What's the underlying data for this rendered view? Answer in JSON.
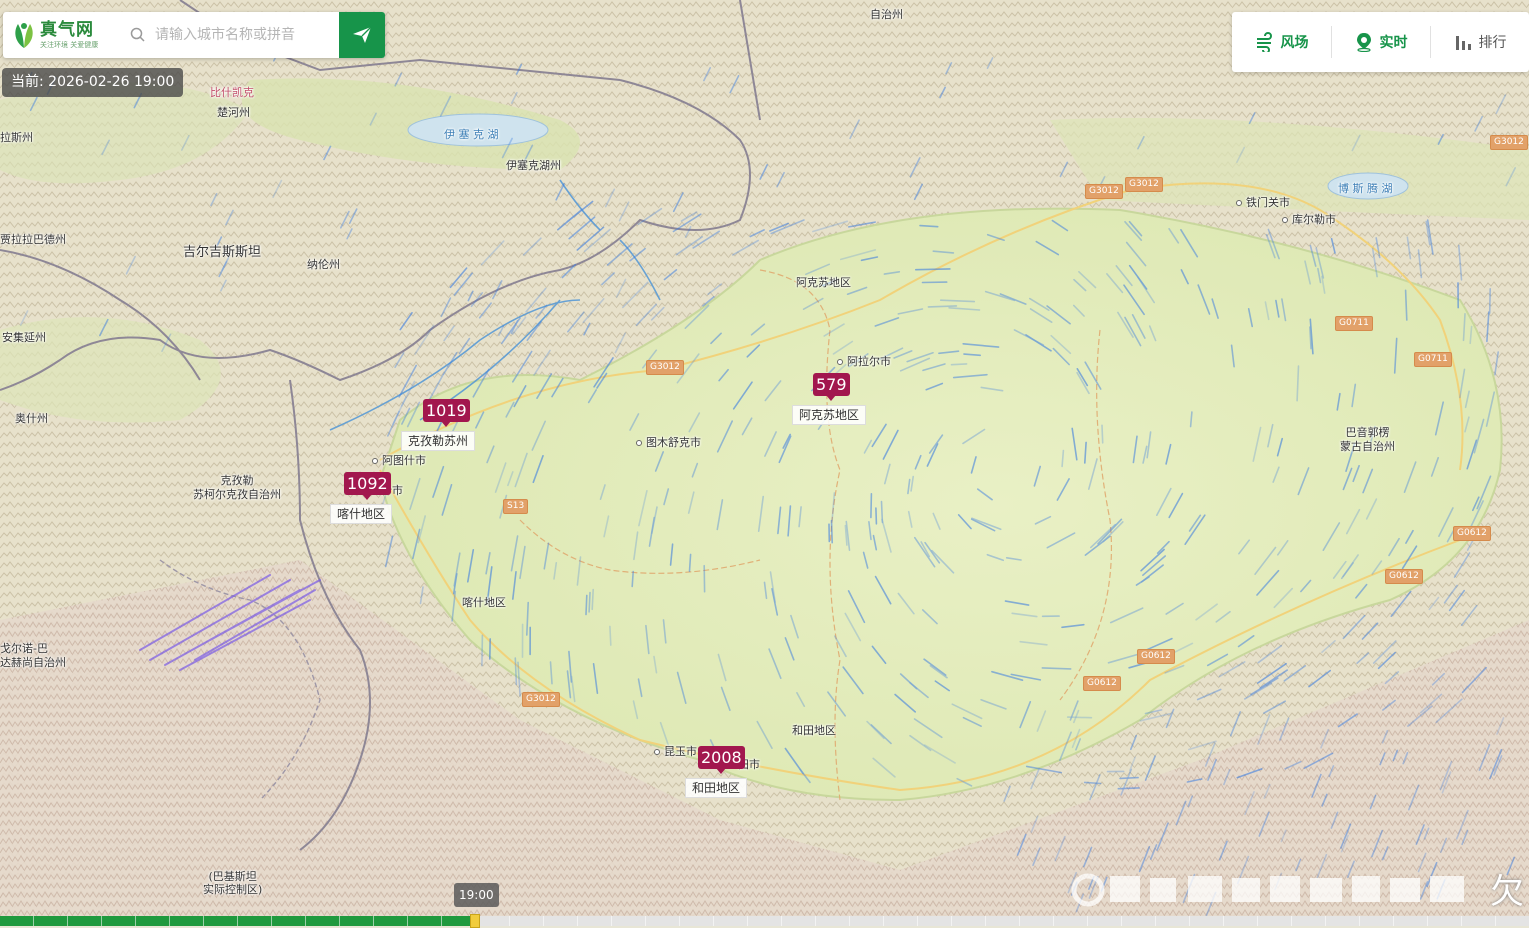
{
  "app": {
    "logo_title": "真气网",
    "logo_slogan": "关注环境  关爱健康",
    "search_placeholder": "请输入城市名称或拼音"
  },
  "current_time": "当前: 2026-02-26 19:00",
  "toolbar": {
    "wind": "风场",
    "realtime": "实时",
    "ranking": "排行"
  },
  "map_labels": {
    "region_top": "自治州",
    "bishkek": "比什凯克",
    "chui": "楚河州",
    "ysyk_lake": "伊 塞 克 湖",
    "ysyk_oblast": "伊塞克湖州",
    "talas": "拉斯州",
    "jalal": "贾拉拉巴德州",
    "kyrgyzstan": "吉尔吉斯斯坦",
    "naryn": "纳伦州",
    "andijan": "安集延州",
    "osh": "奥什州",
    "kizilsu": "克孜勒\n苏柯尔克孜自治州",
    "artux": "阿图什市",
    "kashgar_city": "什市",
    "kashi_region": "喀什地区",
    "tumxuk": "图木舒克市",
    "aksu_region": "阿克苏地区",
    "alar": "阿拉尔市",
    "tiemenguan": "铁门关市",
    "korla": "库尔勒市",
    "bosten": "博 斯 腾 湖",
    "bayingolin": "巴音郭楞\n蒙古自治州",
    "hotan_region": "和田地区",
    "kunyu": "昆玉市",
    "hotan_city": "田市",
    "gorno": "戈尔诺-巴\n达赫尚自治州",
    "pakistan": "(巴基斯坦\n实际控制区)"
  },
  "roads": [
    "G3012",
    "G3012",
    "G3012",
    "G3012",
    "G3012",
    "S13",
    "G0711",
    "G0711",
    "G0612",
    "G0612",
    "G0612",
    "G0612"
  ],
  "aqi_markers": [
    {
      "value": "1019",
      "name": "克孜勒苏州"
    },
    {
      "value": "1092",
      "name": "喀什地区"
    },
    {
      "value": "579",
      "name": "阿克苏地区"
    },
    {
      "value": "2008",
      "name": "和田地区"
    }
  ],
  "timeline": {
    "current_label": "19:00",
    "progress_fraction": 0.31,
    "corner_char": "欠"
  },
  "colors": {
    "brand_green": "#17944a",
    "aqi_marker": "#a2174e",
    "basin": "#e4ecbf",
    "mountain": "#ddd6c0",
    "river": "#5a9bd5",
    "wind": "#3f7fe0"
  }
}
